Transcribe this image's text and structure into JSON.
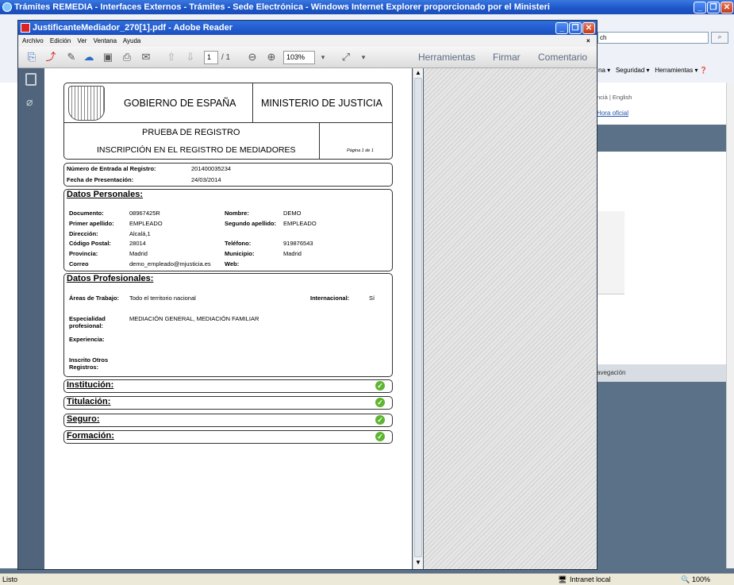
{
  "ie": {
    "title": "Trámites REMEDIA - Interfaces Externos - Trámites - Sede Electrónica - Windows Internet Explorer proporcionado por el Ministeri",
    "search_fragment": "ch",
    "menu_right": [
      "na",
      "Seguridad",
      "Herramientas"
    ],
    "bg_links": [
      "ncià | English",
      "Hora oficial"
    ],
    "bg_nav": "avegación",
    "status_left": "Listo",
    "status_zone": "Intranet local",
    "status_zoom": "100%"
  },
  "reader": {
    "title": "JustificanteMediador_270[1].pdf - Adobe Reader",
    "menu": [
      "Archivo",
      "Edición",
      "Ver",
      "Ventana",
      "Ayuda"
    ],
    "page_current": "1",
    "page_total": "/ 1",
    "zoom": "103%",
    "right_tools": [
      "Herramientas",
      "Firmar",
      "Comentario"
    ]
  },
  "doc": {
    "gov": "GOBIERNO DE ESPAÑA",
    "ministry": "MINISTERIO DE JUSTICIA",
    "proof": "PRUEBA DE REGISTRO",
    "subtitle": "INSCRIPCIÓN EN EL REGISTRO DE MEDIADORES",
    "page": "Página 1 de   1",
    "entry_label": "Número de Entrada al Registro:",
    "entry_value": "201400035234",
    "date_label": "Fecha de Presentación:",
    "date_value": "24/03/2014",
    "personal_title": "Datos Personales:",
    "personal": {
      "doc_l": "Documento:",
      "doc_v": "08967425R",
      "name_l": "Nombre:",
      "name_v": "DEMO",
      "ap1_l": "Primer apellido:",
      "ap1_v": "EMPLEADO",
      "ap2_l": "Segundo apellido:",
      "ap2_v": "EMPLEADO",
      "dir_l": "Dirección:",
      "dir_v": "Alcalá,1",
      "cp_l": "Código Postal:",
      "cp_v": "28014",
      "tel_l": "Teléfono:",
      "tel_v": "919876543",
      "prov_l": "Provincia:",
      "prov_v": "Madrid",
      "mun_l": "Municipio:",
      "mun_v": "Madrid",
      "mail_l": "Correo",
      "mail_v": "demo_empleado@mjusticia.es",
      "web_l": "Web:"
    },
    "prof_title": "Datos Profesionales:",
    "prof": {
      "areas_l": "Áreas de Trabajo:",
      "areas_v": "Todo el territorio nacional",
      "intl_l": "Internacional:",
      "intl_v": "Sí",
      "esp_l1": "Especialidad",
      "esp_l2": "profesional:",
      "esp_v": "MEDIACIÓN GENERAL, MEDIACIÓN FAMILIAR",
      "exp_l": "Experiencia:",
      "otros_l1": "Inscrito Otros",
      "otros_l2": "Registros:"
    },
    "sections": [
      "Institución:",
      "Titulación:",
      "Seguro:",
      "Formación:"
    ]
  }
}
